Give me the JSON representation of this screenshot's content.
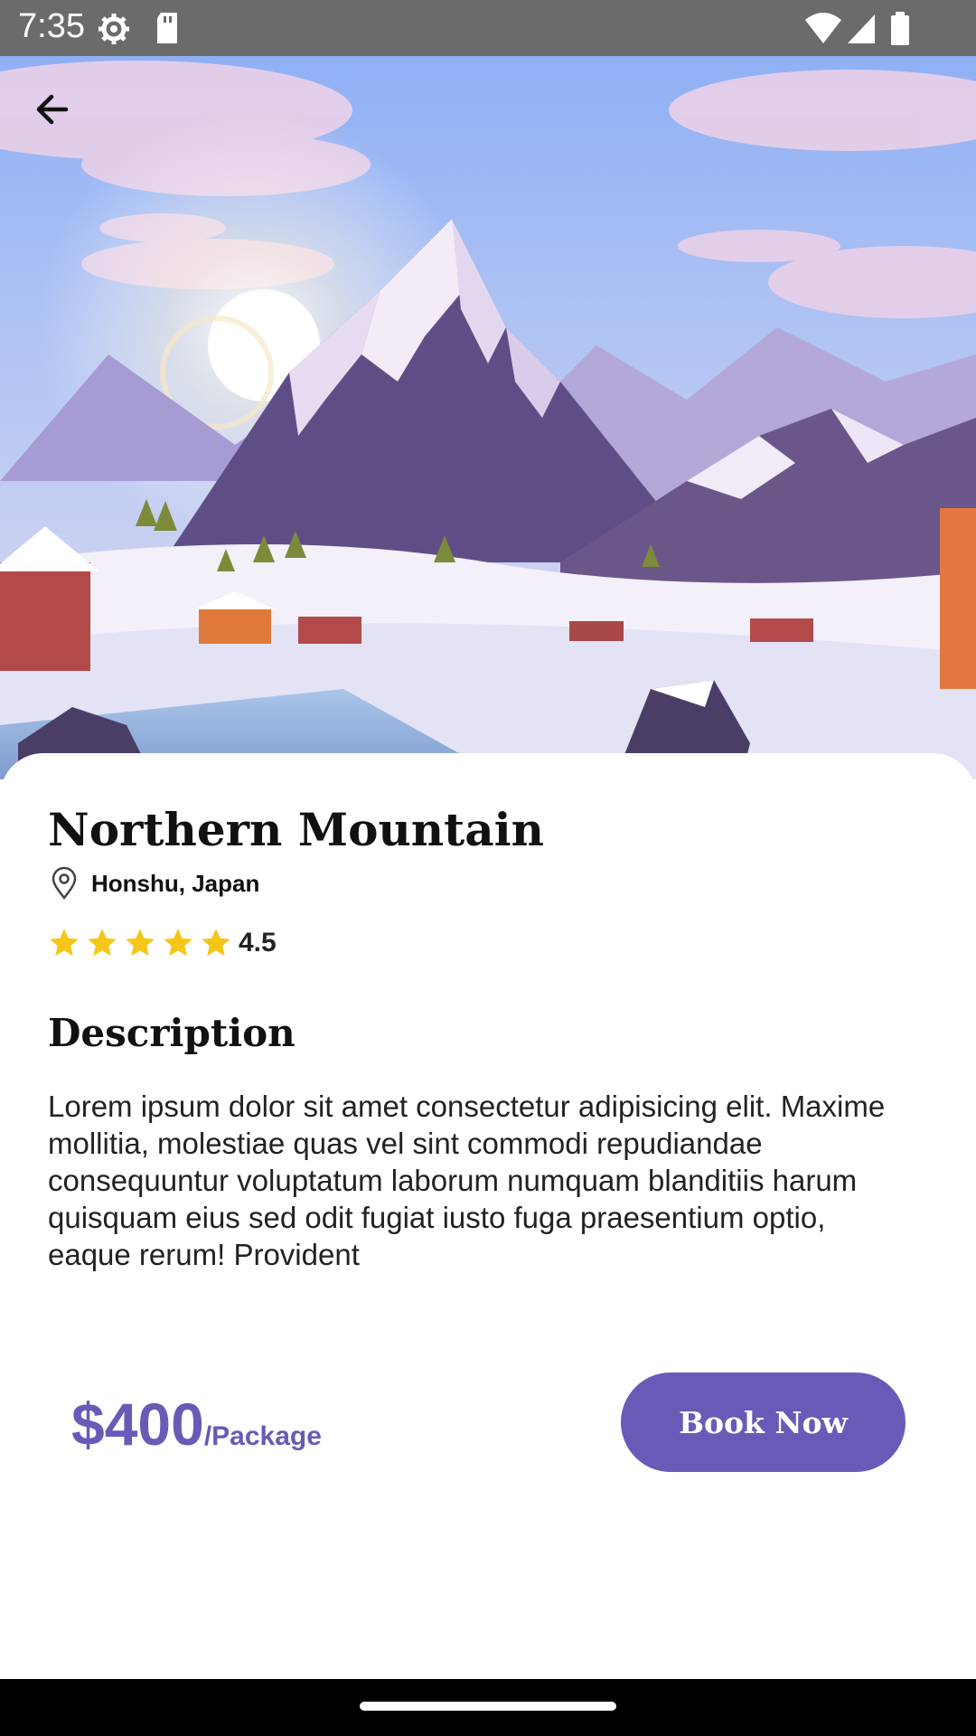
{
  "status_bar": {
    "time": "7:35",
    "icons": [
      "settings-icon",
      "sd-card-icon",
      "wifi-icon",
      "signal-icon",
      "battery-icon"
    ]
  },
  "header": {
    "back_icon": "arrow-back-icon"
  },
  "destination": {
    "title": "Northern Mountain",
    "location": "Honshu, Japan",
    "rating_value": "4.5",
    "stars": 5
  },
  "description": {
    "heading": "Description",
    "body": "Lorem ipsum dolor sit amet consectetur adipisicing elit. Maxime mollitia, molestiae quas vel sint commodi repudiandae consequuntur voluptatum laborum numquam blanditiis harum quisquam eius sed odit fugiat iusto fuga praesentium optio, eaque rerum! Provident"
  },
  "booking": {
    "price": "$400",
    "unit": "/Package",
    "button_label": "Book Now"
  },
  "colors": {
    "accent": "#6a5ab8",
    "star": "#f5c518",
    "status_bar": "#6b6b6b"
  }
}
